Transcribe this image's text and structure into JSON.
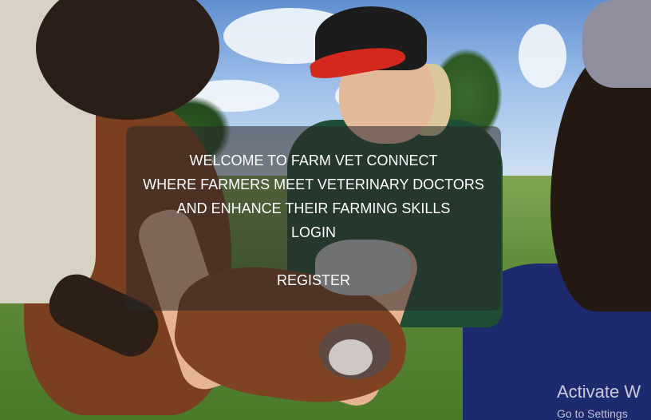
{
  "hero": {
    "line1": "WELCOME TO FARM VET CONNECT",
    "line2": "WHERE FARMERS MEET VETERINARY DOCTORS",
    "line3": "AND ENHANCE THEIR FARMING SKILLS",
    "login_label": "LOGIN",
    "register_label": "REGISTER"
  },
  "watermark": {
    "title": "Activate W",
    "subtitle": "Go to Settings"
  }
}
